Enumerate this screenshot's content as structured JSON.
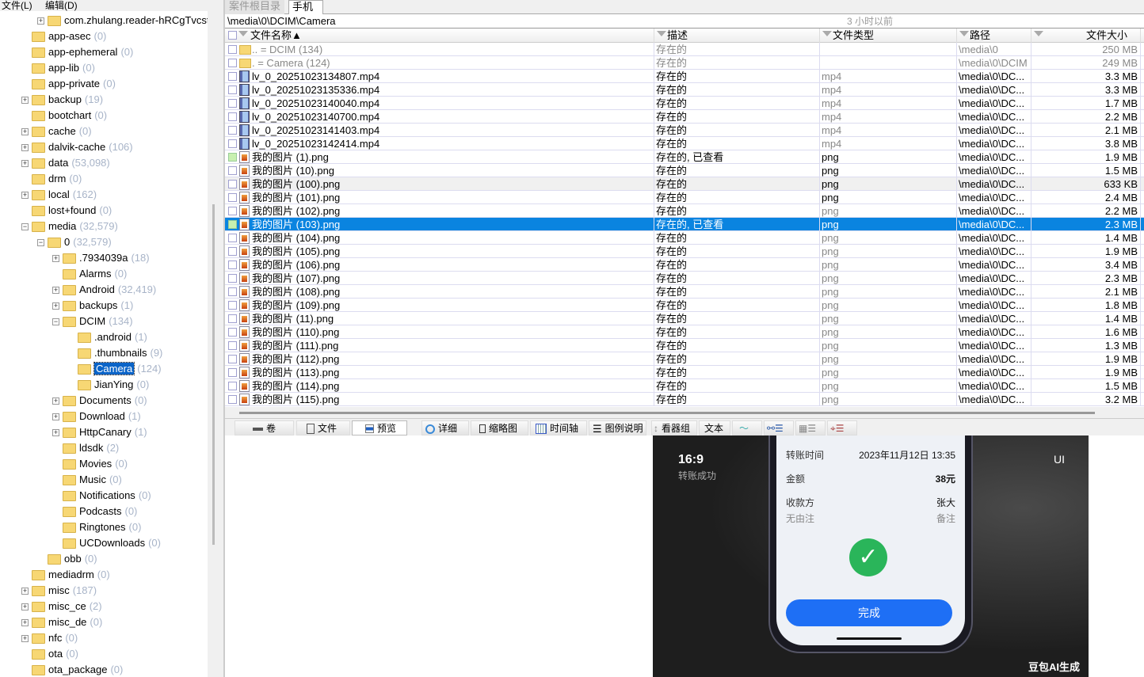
{
  "menu": {
    "file": "文件(L)",
    "edit": "编辑(D)"
  },
  "tree": [
    {
      "name": "com.zhulang.reader-hRCgTvcst",
      "count": "",
      "level": 2,
      "exp": "+"
    },
    {
      "name": "app-asec",
      "count": "(0)",
      "level": 1,
      "exp": ""
    },
    {
      "name": "app-ephemeral",
      "count": "(0)",
      "level": 1,
      "exp": ""
    },
    {
      "name": "app-lib",
      "count": "(0)",
      "level": 1,
      "exp": ""
    },
    {
      "name": "app-private",
      "count": "(0)",
      "level": 1,
      "exp": ""
    },
    {
      "name": "backup",
      "count": "(19)",
      "level": 1,
      "exp": "+"
    },
    {
      "name": "bootchart",
      "count": "(0)",
      "level": 1,
      "exp": ""
    },
    {
      "name": "cache",
      "count": "(0)",
      "level": 1,
      "exp": "+"
    },
    {
      "name": "dalvik-cache",
      "count": "(106)",
      "level": 1,
      "exp": "+"
    },
    {
      "name": "data",
      "count": "(53,098)",
      "level": 1,
      "exp": "+"
    },
    {
      "name": "drm",
      "count": "(0)",
      "level": 1,
      "exp": ""
    },
    {
      "name": "local",
      "count": "(162)",
      "level": 1,
      "exp": "+"
    },
    {
      "name": "lost+found",
      "count": "(0)",
      "level": 1,
      "exp": ""
    },
    {
      "name": "media",
      "count": "(32,579)",
      "level": 1,
      "exp": "-"
    },
    {
      "name": "0",
      "count": "(32,579)",
      "level": 2,
      "exp": "-"
    },
    {
      "name": ".7934039a",
      "count": "(18)",
      "level": 3,
      "exp": "+"
    },
    {
      "name": "Alarms",
      "count": "(0)",
      "level": 3,
      "exp": ""
    },
    {
      "name": "Android",
      "count": "(32,419)",
      "level": 3,
      "exp": "+"
    },
    {
      "name": "backups",
      "count": "(1)",
      "level": 3,
      "exp": "+"
    },
    {
      "name": "DCIM",
      "count": "(134)",
      "level": 3,
      "exp": "-"
    },
    {
      "name": ".android",
      "count": "(1)",
      "level": 4,
      "exp": ""
    },
    {
      "name": ".thumbnails",
      "count": "(9)",
      "level": 4,
      "exp": ""
    },
    {
      "name": "Camera",
      "count": "(124)",
      "level": 4,
      "exp": "",
      "selected": true
    },
    {
      "name": "JianYing",
      "count": "(0)",
      "level": 4,
      "exp": ""
    },
    {
      "name": "Documents",
      "count": "(0)",
      "level": 3,
      "exp": "+"
    },
    {
      "name": "Download",
      "count": "(1)",
      "level": 3,
      "exp": "+"
    },
    {
      "name": "HttpCanary",
      "count": "(1)",
      "level": 3,
      "exp": "+"
    },
    {
      "name": "ldsdk",
      "count": "(2)",
      "level": 3,
      "exp": ""
    },
    {
      "name": "Movies",
      "count": "(0)",
      "level": 3,
      "exp": ""
    },
    {
      "name": "Music",
      "count": "(0)",
      "level": 3,
      "exp": ""
    },
    {
      "name": "Notifications",
      "count": "(0)",
      "level": 3,
      "exp": ""
    },
    {
      "name": "Podcasts",
      "count": "(0)",
      "level": 3,
      "exp": ""
    },
    {
      "name": "Ringtones",
      "count": "(0)",
      "level": 3,
      "exp": ""
    },
    {
      "name": "UCDownloads",
      "count": "(0)",
      "level": 3,
      "exp": ""
    },
    {
      "name": "obb",
      "count": "(0)",
      "level": 2,
      "exp": ""
    },
    {
      "name": "mediadrm",
      "count": "(0)",
      "level": 1,
      "exp": ""
    },
    {
      "name": "misc",
      "count": "(187)",
      "level": 1,
      "exp": "+"
    },
    {
      "name": "misc_ce",
      "count": "(2)",
      "level": 1,
      "exp": "+"
    },
    {
      "name": "misc_de",
      "count": "(0)",
      "level": 1,
      "exp": "+"
    },
    {
      "name": "nfc",
      "count": "(0)",
      "level": 1,
      "exp": "+"
    },
    {
      "name": "ota",
      "count": "(0)",
      "level": 1,
      "exp": ""
    },
    {
      "name": "ota_package",
      "count": "(0)",
      "level": 1,
      "exp": ""
    }
  ],
  "tabs": [
    {
      "label": "案件根目录",
      "active": false
    },
    {
      "label": "手机",
      "active": true
    }
  ],
  "path": "\\media\\0\\DCIM\\Camera",
  "time_ago": "3 小时以前",
  "columns": {
    "name": "文件名称▲",
    "desc": "描述",
    "type": "文件类型",
    "path": "路径",
    "size": "文件大小"
  },
  "files": [
    {
      "name": "..   =   DCIM (134)",
      "desc": "存在的",
      "type": "",
      "path": "\\media\\0",
      "size": "250 MB",
      "icon": "folder",
      "style": "parent"
    },
    {
      "name": ".    =   Camera (124)",
      "desc": "存在的",
      "type": "",
      "path": "\\media\\0\\DCIM",
      "size": "249 MB",
      "icon": "folder",
      "style": "parent"
    },
    {
      "name": "lv_0_20251023134807.mp4",
      "desc": "存在的",
      "type": "mp4",
      "path": "\\media\\0\\DC...",
      "size": "3.3 MB",
      "icon": "video",
      "typegray": true
    },
    {
      "name": "lv_0_20251023135336.mp4",
      "desc": "存在的",
      "type": "mp4",
      "path": "\\media\\0\\DC...",
      "size": "3.3 MB",
      "icon": "video",
      "typegray": true
    },
    {
      "name": "lv_0_20251023140040.mp4",
      "desc": "存在的",
      "type": "mp4",
      "path": "\\media\\0\\DC...",
      "size": "1.7 MB",
      "icon": "video",
      "typegray": true
    },
    {
      "name": "lv_0_20251023140700.mp4",
      "desc": "存在的",
      "type": "mp4",
      "path": "\\media\\0\\DC...",
      "size": "2.2 MB",
      "icon": "video",
      "typegray": true
    },
    {
      "name": "lv_0_20251023141403.mp4",
      "desc": "存在的",
      "type": "mp4",
      "path": "\\media\\0\\DC...",
      "size": "2.1 MB",
      "icon": "video",
      "typegray": true
    },
    {
      "name": "lv_0_20251023142414.mp4",
      "desc": "存在的",
      "type": "mp4",
      "path": "\\media\\0\\DC...",
      "size": "3.8 MB",
      "icon": "video",
      "typegray": true
    },
    {
      "name": "我的图片 (1).png",
      "desc": "存在的, 已查看",
      "type": "png",
      "path": "\\media\\0\\DC...",
      "size": "1.9 MB",
      "icon": "img",
      "green": true
    },
    {
      "name": "我的图片 (10).png",
      "desc": "存在的",
      "type": "png",
      "path": "\\media\\0\\DC...",
      "size": "1.5 MB",
      "icon": "img"
    },
    {
      "name": "我的图片 (100).png",
      "desc": "存在的",
      "type": "png",
      "path": "\\media\\0\\DC...",
      "size": "633 KB",
      "icon": "img",
      "style": "alt"
    },
    {
      "name": "我的图片 (101).png",
      "desc": "存在的",
      "type": "png",
      "path": "\\media\\0\\DC...",
      "size": "2.4 MB",
      "icon": "img"
    },
    {
      "name": "我的图片 (102).png",
      "desc": "存在的",
      "type": "png",
      "path": "\\media\\0\\DC...",
      "size": "2.2 MB",
      "icon": "img",
      "typegray": true
    },
    {
      "name": "我的图片 (103).png",
      "desc": "存在的, 已查看",
      "type": "png",
      "path": "\\media\\0\\DC...",
      "size": "2.3 MB",
      "icon": "img",
      "green": true,
      "style": "sel"
    },
    {
      "name": "我的图片 (104).png",
      "desc": "存在的",
      "type": "png",
      "path": "\\media\\0\\DC...",
      "size": "1.4 MB",
      "icon": "img",
      "typegray": true
    },
    {
      "name": "我的图片 (105).png",
      "desc": "存在的",
      "type": "png",
      "path": "\\media\\0\\DC...",
      "size": "1.9 MB",
      "icon": "img",
      "typegray": true
    },
    {
      "name": "我的图片 (106).png",
      "desc": "存在的",
      "type": "png",
      "path": "\\media\\0\\DC...",
      "size": "3.4 MB",
      "icon": "img",
      "typegray": true
    },
    {
      "name": "我的图片 (107).png",
      "desc": "存在的",
      "type": "png",
      "path": "\\media\\0\\DC...",
      "size": "2.3 MB",
      "icon": "img",
      "typegray": true
    },
    {
      "name": "我的图片 (108).png",
      "desc": "存在的",
      "type": "png",
      "path": "\\media\\0\\DC...",
      "size": "2.1 MB",
      "icon": "img",
      "typegray": true
    },
    {
      "name": "我的图片 (109).png",
      "desc": "存在的",
      "type": "png",
      "path": "\\media\\0\\DC...",
      "size": "1.8 MB",
      "icon": "img",
      "typegray": true
    },
    {
      "name": "我的图片 (11).png",
      "desc": "存在的",
      "type": "png",
      "path": "\\media\\0\\DC...",
      "size": "1.4 MB",
      "icon": "img",
      "typegray": true
    },
    {
      "name": "我的图片 (110).png",
      "desc": "存在的",
      "type": "png",
      "path": "\\media\\0\\DC...",
      "size": "1.6 MB",
      "icon": "img",
      "typegray": true
    },
    {
      "name": "我的图片 (111).png",
      "desc": "存在的",
      "type": "png",
      "path": "\\media\\0\\DC...",
      "size": "1.3 MB",
      "icon": "img",
      "typegray": true
    },
    {
      "name": "我的图片 (112).png",
      "desc": "存在的",
      "type": "png",
      "path": "\\media\\0\\DC...",
      "size": "1.9 MB",
      "icon": "img",
      "typegray": true
    },
    {
      "name": "我的图片 (113).png",
      "desc": "存在的",
      "type": "png",
      "path": "\\media\\0\\DC...",
      "size": "1.9 MB",
      "icon": "img",
      "typegray": true
    },
    {
      "name": "我的图片 (114).png",
      "desc": "存在的",
      "type": "png",
      "path": "\\media\\0\\DC...",
      "size": "1.5 MB",
      "icon": "img",
      "typegray": true
    },
    {
      "name": "我的图片 (115).png",
      "desc": "存在的",
      "type": "png",
      "path": "\\media\\0\\DC...",
      "size": "3.2 MB",
      "icon": "img",
      "typegray": true
    }
  ],
  "toolbar": {
    "volume": "卷",
    "file": "文件",
    "preview": "预览",
    "details": "详细",
    "thumbnails": "缩略图",
    "timeline": "时间轴",
    "legend": "图例说明",
    "viewer": "看器组",
    "text": "文本"
  },
  "preview": {
    "ratio": "16:9",
    "subtitle": "转账成功",
    "ui_label": "UI",
    "rows": [
      {
        "label": "转账时间",
        "value": "2023年11月12日 13:35"
      },
      {
        "label": "金额",
        "value": "38元"
      },
      {
        "label": "收款方",
        "value": "张大"
      },
      {
        "label": "无由注",
        "value": "备注"
      }
    ],
    "button": "完成",
    "watermark": "豆包AI生成"
  }
}
